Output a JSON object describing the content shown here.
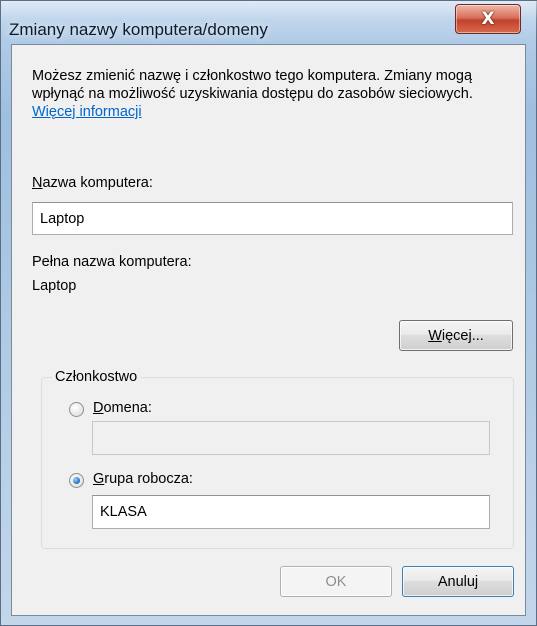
{
  "window": {
    "title": "Zmiany nazwy komputera/domeny",
    "close_glyph": "X"
  },
  "description": {
    "text": "Możesz zmienić nazwę i członkostwo tego komputera. Zmiany mogą wpłynąć na możliwość uzyskiwania dostępu do zasobów sieciowych.",
    "link": "Więcej informacji"
  },
  "computer_name": {
    "label_first_letter": "N",
    "label_rest": "azwa komputera:",
    "value": "Laptop"
  },
  "full_name": {
    "label": "Pełna nazwa komputera:",
    "value": "Laptop"
  },
  "more_button": {
    "label_first_letter": "W",
    "label_rest": "ięcej..."
  },
  "membership": {
    "legend": "Członkostwo",
    "domain": {
      "label_first_letter": "D",
      "label_rest": "omena:",
      "selected": false,
      "value": ""
    },
    "workgroup": {
      "label_first_letter": "G",
      "label_rest": "rupa robocza:",
      "selected": true,
      "value": "KLASA"
    }
  },
  "buttons": {
    "ok": "OK",
    "cancel": "Anuluj"
  },
  "icons": {
    "close": "close-icon",
    "radio": "radio-button"
  },
  "colors": {
    "link": "#0066cc",
    "close_button": "#c0432c"
  }
}
